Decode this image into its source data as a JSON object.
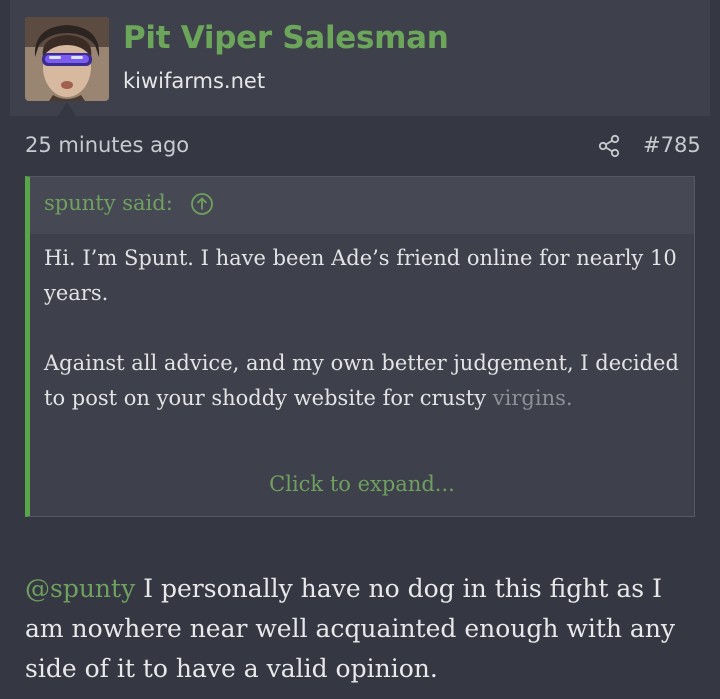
{
  "user": {
    "name": "Pit Viper Salesman",
    "title": "kiwifarms.net",
    "avatar_icon": "avatar-photo-sunglasses"
  },
  "post": {
    "time": "25 minutes ago",
    "share_icon": "share-icon",
    "number": "#785"
  },
  "quote": {
    "author": "spunty said:",
    "jump_icon": "arrow-up-circle-icon",
    "paragraph1": "Hi. I’m Spunt. I have been Ade’s friend online for nearly 10 years.",
    "paragraph2_visible": "Against all advice, and my own better judgement, I decided to post on your shoddy website for crusty",
    "paragraph2_faded": "virgins.",
    "expand_label": "Click to expand..."
  },
  "reply": {
    "mention": "@spunty",
    "text": " I personally have no dog in this fight as I am nowhere near well acquainted enough with any side of it to have a valid opinion."
  },
  "colors": {
    "accent_green": "#6ba65a",
    "quote_border": "#58a54a",
    "background": "#353842",
    "panel": "#3e414b"
  }
}
